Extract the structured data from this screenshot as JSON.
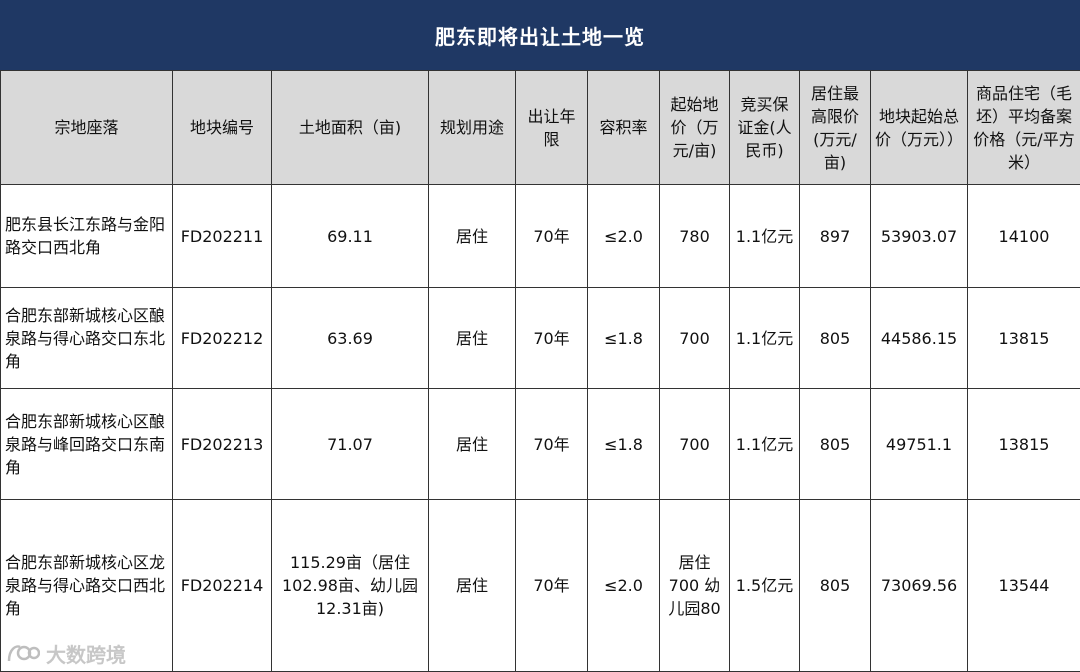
{
  "title": "肥东即将出让土地一览",
  "headers": [
    "宗地座落",
    "地块编号",
    "土地面积（亩)",
    "规划用途",
    "出让年限",
    "容积率",
    "起始地价（万元/亩)",
    "竞买保证金(人民币)",
    "居住最高限价(万元/亩)",
    "地块起始总价（万元））",
    "商品住宅（毛坯）平均备案价格（元/平方米）"
  ],
  "rows": [
    {
      "location": "肥东县长江东路与金阳路交口西北角",
      "code": "FD202211",
      "area": "69.11",
      "use": "居住",
      "term": "70年",
      "far": "≤2.0",
      "start_price": "780",
      "deposit": "1.1亿元",
      "max_price": "897",
      "total_price": "53903.07",
      "avg_price": "14100"
    },
    {
      "location": "合肥东部新城核心区酿泉路与得心路交口东北角",
      "code": "FD202212",
      "area": "63.69",
      "use": "居住",
      "term": "70年",
      "far": "≤1.8",
      "start_price": "700",
      "deposit": "1.1亿元",
      "max_price": "805",
      "total_price": "44586.15",
      "avg_price": "13815"
    },
    {
      "location": "合肥东部新城核心区酿泉路与峰回路交口东南角",
      "code": "FD202213",
      "area": "71.07",
      "use": "居住",
      "term": "70年",
      "far": "≤1.8",
      "start_price": "700",
      "deposit": "1.1亿元",
      "max_price": "805",
      "total_price": "49751.1",
      "avg_price": "13815"
    },
    {
      "location": "合肥东部新城核心区龙泉路与得心路交口西北角",
      "code": "FD202214",
      "area": "115.29亩（居住102.98亩、幼儿园12.31亩)",
      "use": "居住",
      "term": "70年",
      "far": "≤2.0",
      "start_price": "居住700 幼儿园80",
      "deposit": "1.5亿元",
      "max_price": "805",
      "total_price": "73069.56",
      "avg_price": "13544"
    }
  ],
  "watermark": {
    "text": "大数跨境",
    "icon": "brand-logo-icon"
  },
  "colors": {
    "title_bg": "#1f3864",
    "header_bg": "#d9d9d9",
    "border": "#333333"
  }
}
